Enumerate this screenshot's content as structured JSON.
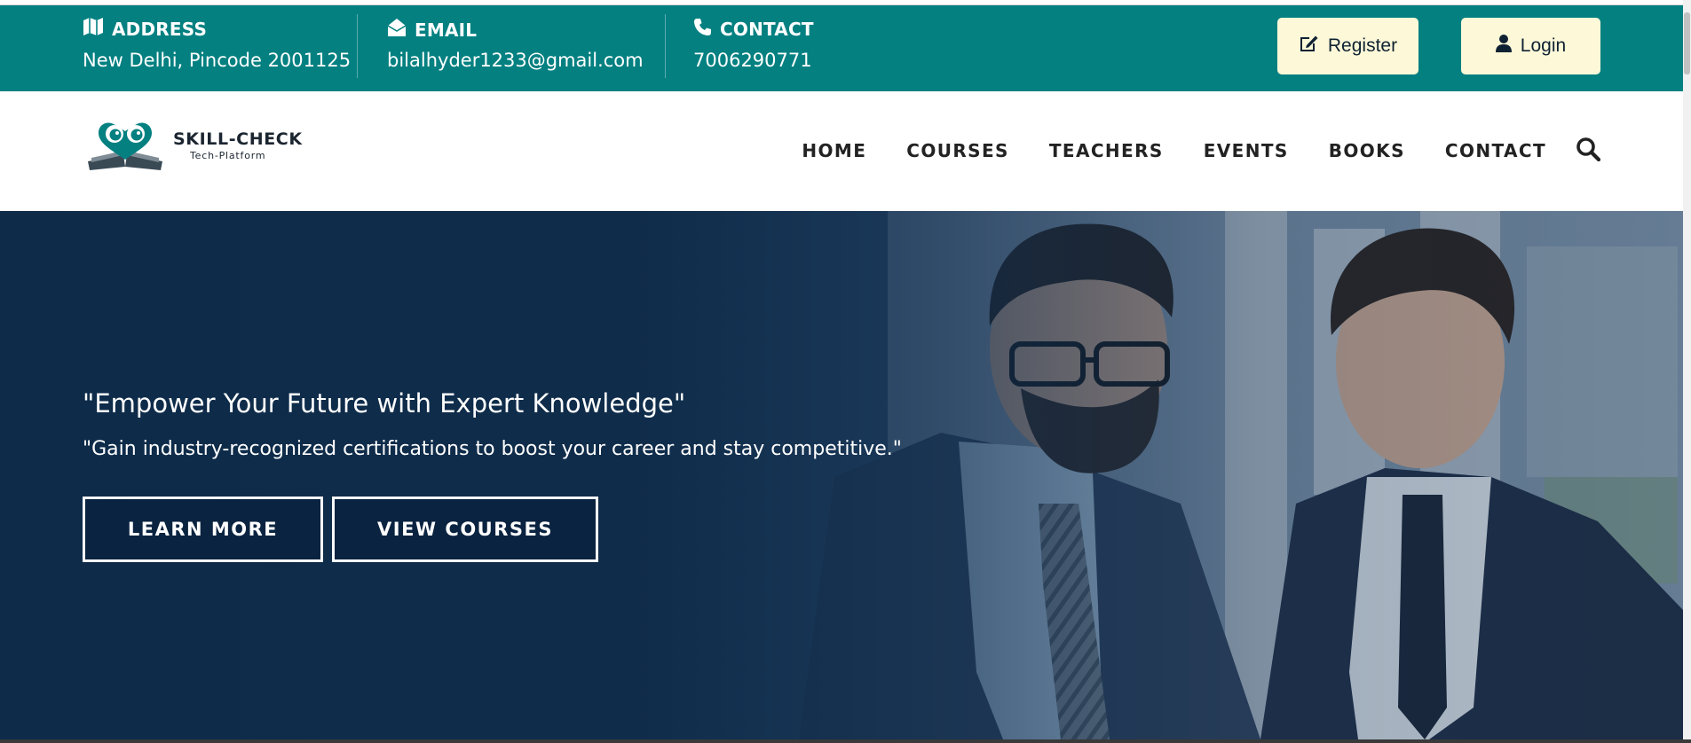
{
  "topbar": {
    "address": {
      "label": "ADDRESS",
      "value": "New Delhi, Pincode 2001125",
      "icon": "map-icon"
    },
    "email": {
      "label": "EMAIL",
      "value": "bilalhyder1233@gmail.com",
      "icon": "envelope-open-icon"
    },
    "contact": {
      "label": "CONTACT",
      "value": "7006290771",
      "icon": "phone-icon"
    },
    "register_label": "Register",
    "login_label": "Login",
    "colors": {
      "bar": "#048081",
      "button_bg": "#fdf8d8"
    }
  },
  "navbar": {
    "logo_title": "SKILL-CHECK",
    "logo_subtitle": "Tech-Platform",
    "items": [
      "HOME",
      "COURSES",
      "TEACHERS",
      "EVENTS",
      "BOOKS",
      "CONTACT"
    ],
    "search_icon": "search-icon"
  },
  "hero": {
    "title": "\"Empower Your Future with Expert Knowledge\"",
    "subtitle": "\"Gain industry-recognized certifications to boost your career and stay competitive.\"",
    "learn_more_label": "LEARN MORE",
    "view_courses_label": "VIEW COURSES",
    "overlay_color": "#0d2a48"
  }
}
